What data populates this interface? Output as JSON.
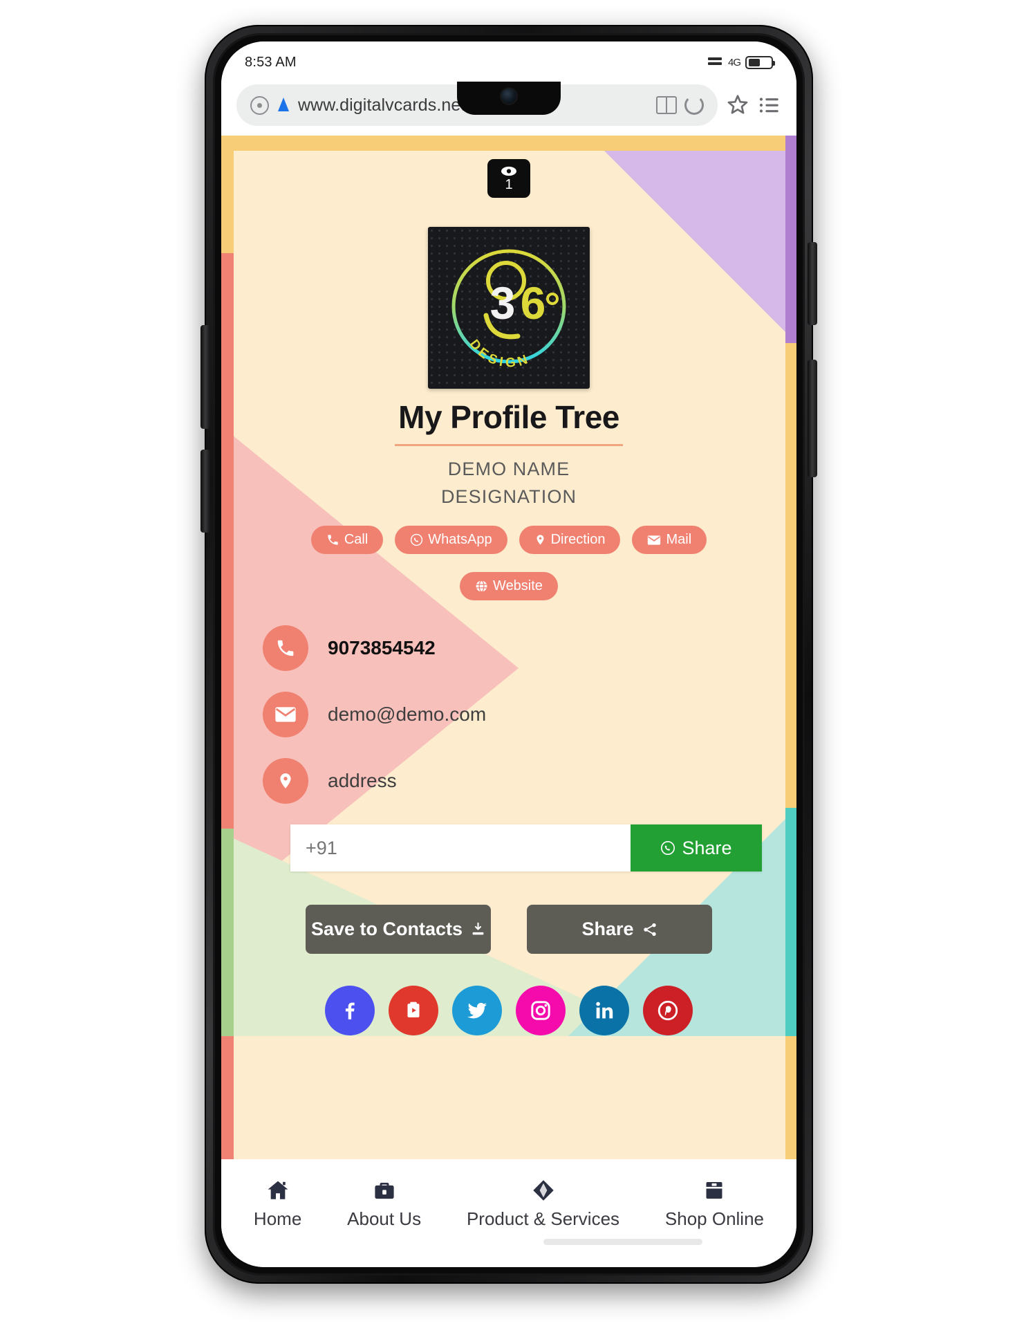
{
  "device": {
    "status_bar": {
      "time": "8:53 AM",
      "signal_icon": "signal-icon",
      "data_icon": "4G",
      "battery_icon": "battery-icon"
    },
    "nav_bar": {
      "recents": "recents-square",
      "home": "home-circle",
      "back": "back-triangle"
    }
  },
  "browser": {
    "url": "www.digitalvcards.net",
    "security_icon": "lock-icon",
    "compass_icon": "compass-icon",
    "reader_icon": "book-icon",
    "reload_icon": "reload-icon",
    "bookmark_icon": "star-icon",
    "menu_icon": "list-icon"
  },
  "vcard": {
    "view_badge": {
      "icon": "eye-icon",
      "count": "1"
    },
    "logo": {
      "alt": "360 Design logo",
      "text_main": "360",
      "text_sub": "DESIGN",
      "degree": "°"
    },
    "title": "My Profile Tree",
    "name": "DEMO NAME",
    "designation": "DESIGNATION",
    "quick_actions": [
      {
        "label": "Call",
        "icon": "phone-icon"
      },
      {
        "label": "WhatsApp",
        "icon": "whatsapp-icon"
      },
      {
        "label": "Direction",
        "icon": "map-pin-icon"
      },
      {
        "label": "Mail",
        "icon": "envelope-icon"
      },
      {
        "label": "Website",
        "icon": "globe-icon"
      }
    ],
    "contacts": [
      {
        "icon": "phone-icon",
        "value": "9073854542",
        "bold": true
      },
      {
        "icon": "envelope-icon",
        "value": "demo@demo.com",
        "bold": false
      },
      {
        "icon": "map-pin-icon",
        "value": "address",
        "bold": false
      }
    ],
    "whatsapp_share": {
      "input_placeholder": "+91",
      "input_value": "",
      "button_label": "Share",
      "button_icon": "whatsapp-icon",
      "button_color": "#22a033"
    },
    "actions": [
      {
        "label": "Save to Contacts",
        "icon": "download-icon"
      },
      {
        "label": "Share",
        "icon": "share-alt-icon"
      }
    ],
    "social": [
      {
        "name": "facebook",
        "icon": "facebook-icon",
        "color": "#4c50ef"
      },
      {
        "name": "youtube",
        "icon": "youtube-icon",
        "color": "#e0382c"
      },
      {
        "name": "twitter",
        "icon": "twitter-icon",
        "color": "#1d9bd7"
      },
      {
        "name": "instagram",
        "icon": "instagram-icon",
        "color": "#f50bab"
      },
      {
        "name": "linkedin",
        "icon": "linkedin-icon",
        "color": "#0b72a8"
      },
      {
        "name": "pinterest",
        "icon": "pinterest-icon",
        "color": "#cc1f26"
      }
    ],
    "bottom_nav": [
      {
        "label": "Home",
        "icon": "house-icon"
      },
      {
        "label": "About Us",
        "icon": "briefcase-icon"
      },
      {
        "label": "Product & Services",
        "icon": "gem-icon"
      },
      {
        "label": "Shop Online",
        "icon": "store-icon"
      }
    ],
    "colors": {
      "background": "#fdeccd",
      "accent": "#f0806f",
      "frame_top": "#f8cd77",
      "frame_left": "#f08273",
      "shape_purple": "#d6b9e8",
      "shape_pink": "#f7c0bb",
      "shape_green": "#dfeccd",
      "shape_teal": "#b6e5dd",
      "title_rule": "#f0a57e",
      "button_gray": "#5d5c55"
    }
  }
}
